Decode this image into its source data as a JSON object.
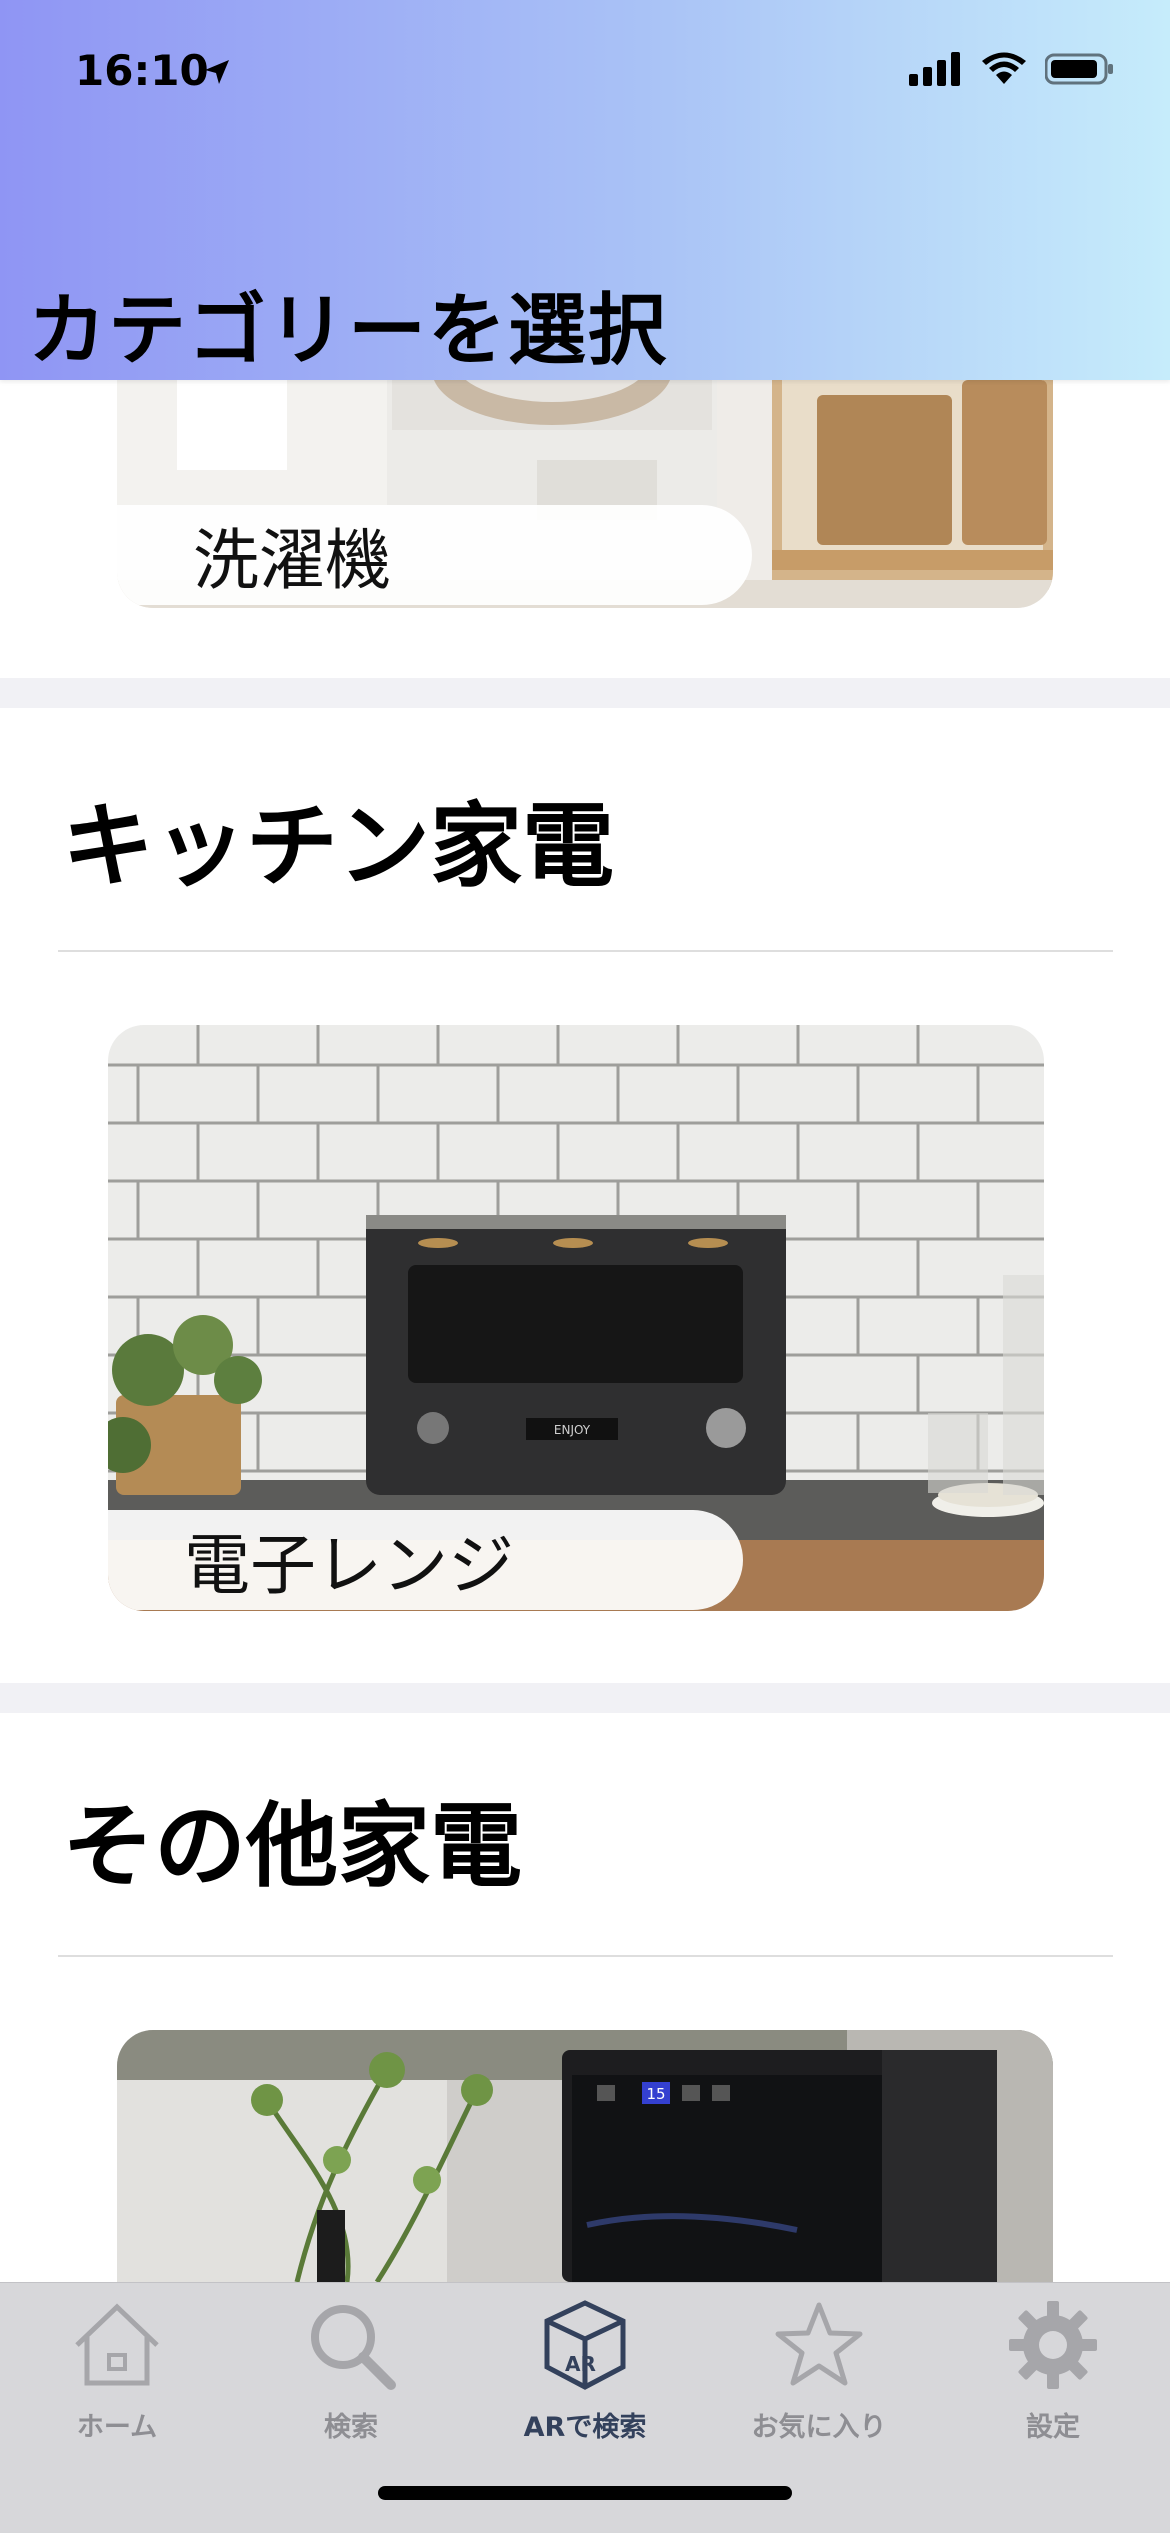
{
  "status_bar": {
    "time": "16:10"
  },
  "header": {
    "title": "カテゴリーを選択"
  },
  "cards": {
    "washer": {
      "label": "洗濯機"
    },
    "microwave": {
      "label": "電子レンジ",
      "panel_text": "ENJOY"
    },
    "wine_cellar": {
      "display_text": "15"
    }
  },
  "sections": {
    "kitchen": {
      "title": "キッチン家電"
    },
    "other": {
      "title": "その他家電"
    }
  },
  "tab_bar": {
    "items": [
      {
        "label": "ホーム",
        "icon": "home-icon"
      },
      {
        "label": "検索",
        "icon": "search-icon"
      },
      {
        "label": "ARで検索",
        "icon": "ar-cube-icon",
        "active": true
      },
      {
        "label": "お気に入り",
        "icon": "star-icon"
      },
      {
        "label": "設定",
        "icon": "gear-icon"
      }
    ]
  },
  "colors": {
    "header_gradient_start": "#8f95f4",
    "header_gradient_end": "#c6ecfb",
    "tab_active": "#33415c",
    "tab_inactive": "#8e8e93"
  }
}
